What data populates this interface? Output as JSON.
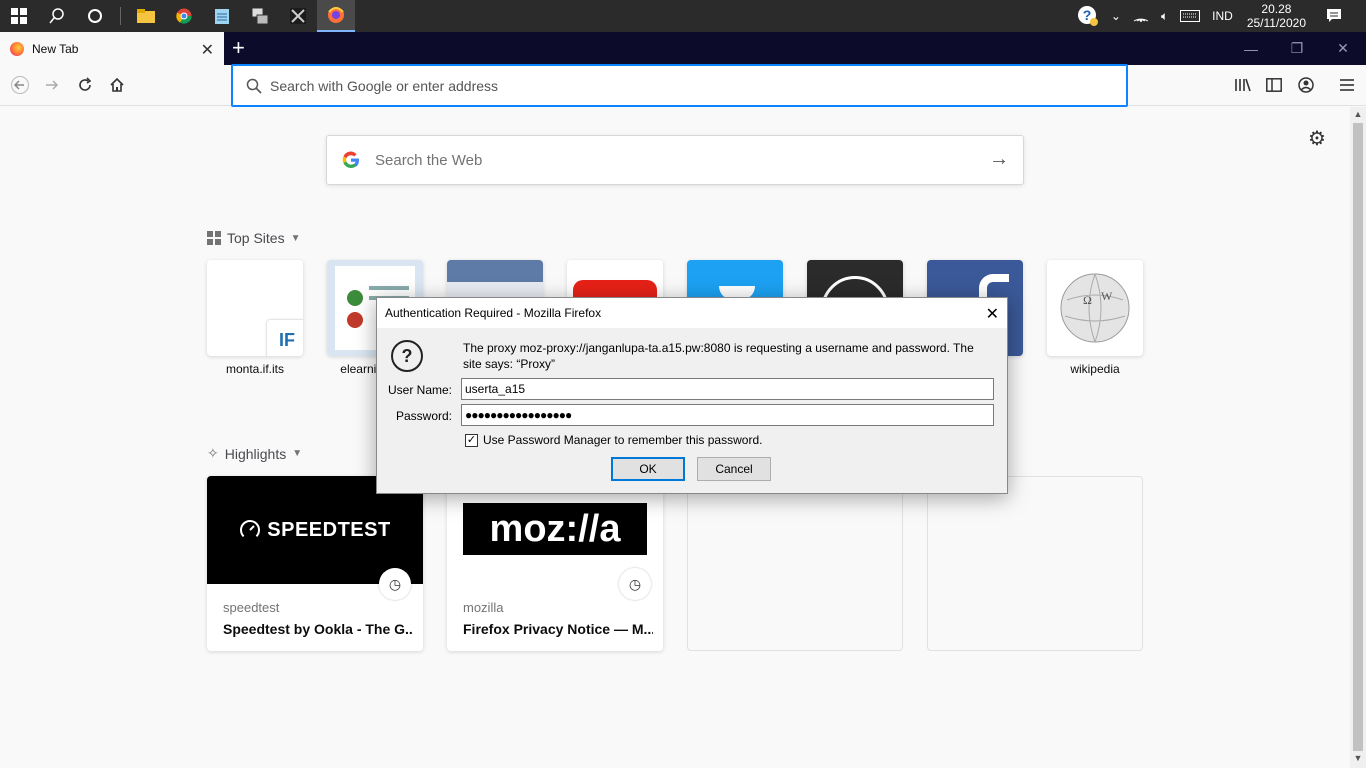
{
  "taskbar": {
    "clock_time": "20.28",
    "clock_date": "25/11/2020",
    "language": "IND"
  },
  "browser": {
    "tab_title": "New Tab",
    "url_placeholder": "Search with Google or enter address"
  },
  "newtab": {
    "search_placeholder": "Search the Web",
    "top_sites_heading": "Top Sites",
    "highlights_heading": "Highlights",
    "top_sites": [
      {
        "label": "monta.if.its"
      },
      {
        "label": "elearnin"
      },
      {
        "label": ""
      },
      {
        "label": ""
      },
      {
        "label": ""
      },
      {
        "label": ""
      },
      {
        "label": ""
      },
      {
        "label": "wikipedia"
      }
    ],
    "highlights": [
      {
        "source": "speedtest",
        "title": "Speedtest by Ookla - The G...",
        "image_text": "SPEEDTEST"
      },
      {
        "source": "mozilla",
        "title": "Firefox Privacy Notice — M...",
        "image_text": "moz://a"
      }
    ]
  },
  "dialog": {
    "title": "Authentication Required - Mozilla Firefox",
    "message": "The proxy moz-proxy://janganlupa-ta.a15.pw:8080 is requesting a username and password. The site says: “Proxy”",
    "username_label": "User Name:",
    "username_value": "userta_a15",
    "password_label": "Password:",
    "password_value": "●●●●●●●●●●●●●●●●●",
    "remember_label": "Use Password Manager to remember this password.",
    "remember_checked": true,
    "ok_label": "OK",
    "cancel_label": "Cancel"
  }
}
